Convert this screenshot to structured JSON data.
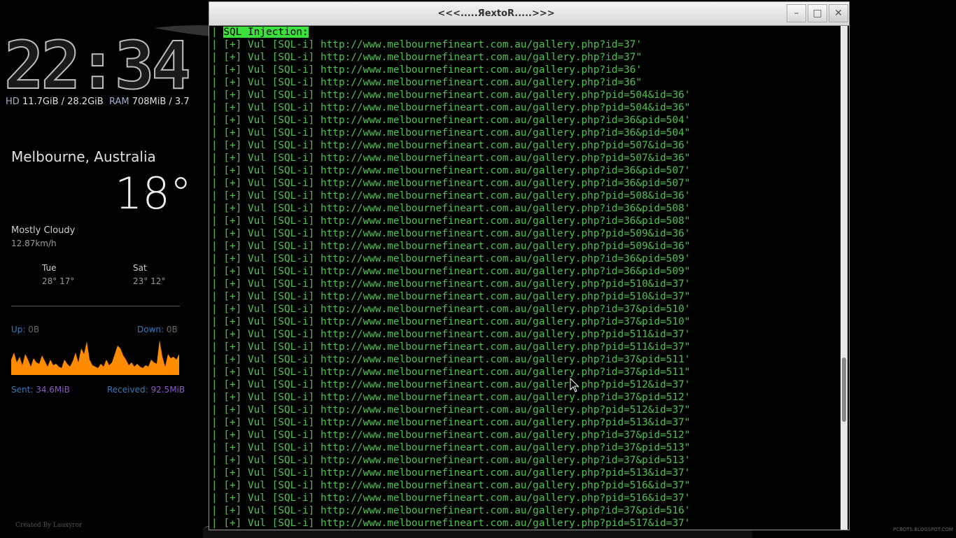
{
  "conky": {
    "clock": "22:34",
    "hd_label": "HD",
    "hd_value": "11.7GiB / 28.2GiB",
    "ram_label": "RAM",
    "ram_value": "708MiB / 3.7",
    "city": "Melbourne, Australia",
    "temperature": "18°",
    "condition": "Mostly Cloudy",
    "wind": "12.87km/h",
    "forecast": [
      {
        "day": "Tue",
        "temps": "28° 17°"
      },
      {
        "day": "Sat",
        "temps": "23° 12°"
      }
    ],
    "up_label": "Up:",
    "up_value": "0B",
    "down_label": "Down:",
    "down_value": "0B",
    "sent_label": "Sent:",
    "sent_value": "34.6MiB",
    "received_label": "Received:",
    "received_value": "92.5MiB",
    "credit": "Created By Lauxyror",
    "graph_color": "#ff8c00"
  },
  "watermark": "PCBOTS.BLOGSPOT.COM",
  "window": {
    "title": "<<<.....ЯextoR.....>>>",
    "minimize_icon": "minimize-icon",
    "maximize_icon": "maximize-icon",
    "close_icon": "close-icon"
  },
  "terminal": {
    "text_color": "#4ec24e",
    "header_prefix": "| ",
    "header": "SQL Injection:",
    "lines": [
      "| [+] Vul [SQL-i] http://www.melbournefineart.com.au/gallery.php?id=37'",
      "| [+] Vul [SQL-i] http://www.melbournefineart.com.au/gallery.php?id=37\"",
      "| [+] Vul [SQL-i] http://www.melbournefineart.com.au/gallery.php?id=36'",
      "| [+] Vul [SQL-i] http://www.melbournefineart.com.au/gallery.php?id=36\"",
      "| [+] Vul [SQL-i] http://www.melbournefineart.com.au/gallery.php?pid=504&id=36'",
      "| [+] Vul [SQL-i] http://www.melbournefineart.com.au/gallery.php?pid=504&id=36\"",
      "| [+] Vul [SQL-i] http://www.melbournefineart.com.au/gallery.php?id=36&pid=504'",
      "| [+] Vul [SQL-i] http://www.melbournefineart.com.au/gallery.php?id=36&pid=504\"",
      "| [+] Vul [SQL-i] http://www.melbournefineart.com.au/gallery.php?pid=507&id=36'",
      "| [+] Vul [SQL-i] http://www.melbournefineart.com.au/gallery.php?pid=507&id=36\"",
      "| [+] Vul [SQL-i] http://www.melbournefineart.com.au/gallery.php?id=36&pid=507'",
      "| [+] Vul [SQL-i] http://www.melbournefineart.com.au/gallery.php?id=36&pid=507\"",
      "| [+] Vul [SQL-i] http://www.melbournefineart.com.au/gallery.php?pid=508&id=36'",
      "| [+] Vul [SQL-i] http://www.melbournefineart.com.au/gallery.php?id=36&pid=508'",
      "| [+] Vul [SQL-i] http://www.melbournefineart.com.au/gallery.php?id=36&pid=508\"",
      "| [+] Vul [SQL-i] http://www.melbournefineart.com.au/gallery.php?pid=509&id=36'",
      "| [+] Vul [SQL-i] http://www.melbournefineart.com.au/gallery.php?pid=509&id=36\"",
      "| [+] Vul [SQL-i] http://www.melbournefineart.com.au/gallery.php?id=36&pid=509'",
      "| [+] Vul [SQL-i] http://www.melbournefineart.com.au/gallery.php?id=36&pid=509\"",
      "| [+] Vul [SQL-i] http://www.melbournefineart.com.au/gallery.php?pid=510&id=37'",
      "| [+] Vul [SQL-i] http://www.melbournefineart.com.au/gallery.php?pid=510&id=37\"",
      "| [+] Vul [SQL-i] http://www.melbournefineart.com.au/gallery.php?id=37&pid=510'",
      "| [+] Vul [SQL-i] http://www.melbournefineart.com.au/gallery.php?id=37&pid=510\"",
      "| [+] Vul [SQL-i] http://www.melbournefineart.com.au/gallery.php?pid=511&id=37'",
      "| [+] Vul [SQL-i] http://www.melbournefineart.com.au/gallery.php?pid=511&id=37\"",
      "| [+] Vul [SQL-i] http://www.melbournefineart.com.au/gallery.php?id=37&pid=511'",
      "| [+] Vul [SQL-i] http://www.melbournefineart.com.au/gallery.php?id=37&pid=511\"",
      "| [+] Vul [SQL-i] http://www.melbournefineart.com.au/gallery.php?pid=512&id=37'",
      "| [+] Vul [SQL-i] http://www.melbournefineart.com.au/gallery.php?id=37&pid=512'",
      "| [+] Vul [SQL-i] http://www.melbournefineart.com.au/gallery.php?pid=512&id=37\"",
      "| [+] Vul [SQL-i] http://www.melbournefineart.com.au/gallery.php?pid=513&id=37\"",
      "| [+] Vul [SQL-i] http://www.melbournefineart.com.au/gallery.php?id=37&pid=512\"",
      "| [+] Vul [SQL-i] http://www.melbournefineart.com.au/gallery.php?id=37&pid=513\"",
      "| [+] Vul [SQL-i] http://www.melbournefineart.com.au/gallery.php?id=37&pid=513'",
      "| [+] Vul [SQL-i] http://www.melbournefineart.com.au/gallery.php?pid=513&id=37'",
      "| [+] Vul [SQL-i] http://www.melbournefineart.com.au/gallery.php?pid=516&id=37\"",
      "| [+] Vul [SQL-i] http://www.melbournefineart.com.au/gallery.php?pid=516&id=37'",
      "| [+] Vul [SQL-i] http://www.melbournefineart.com.au/gallery.php?id=37&pid=516'",
      "| [+] Vul [SQL-i] http://www.melbournefineart.com.au/gallery.php?pid=517&id=37'"
    ]
  }
}
